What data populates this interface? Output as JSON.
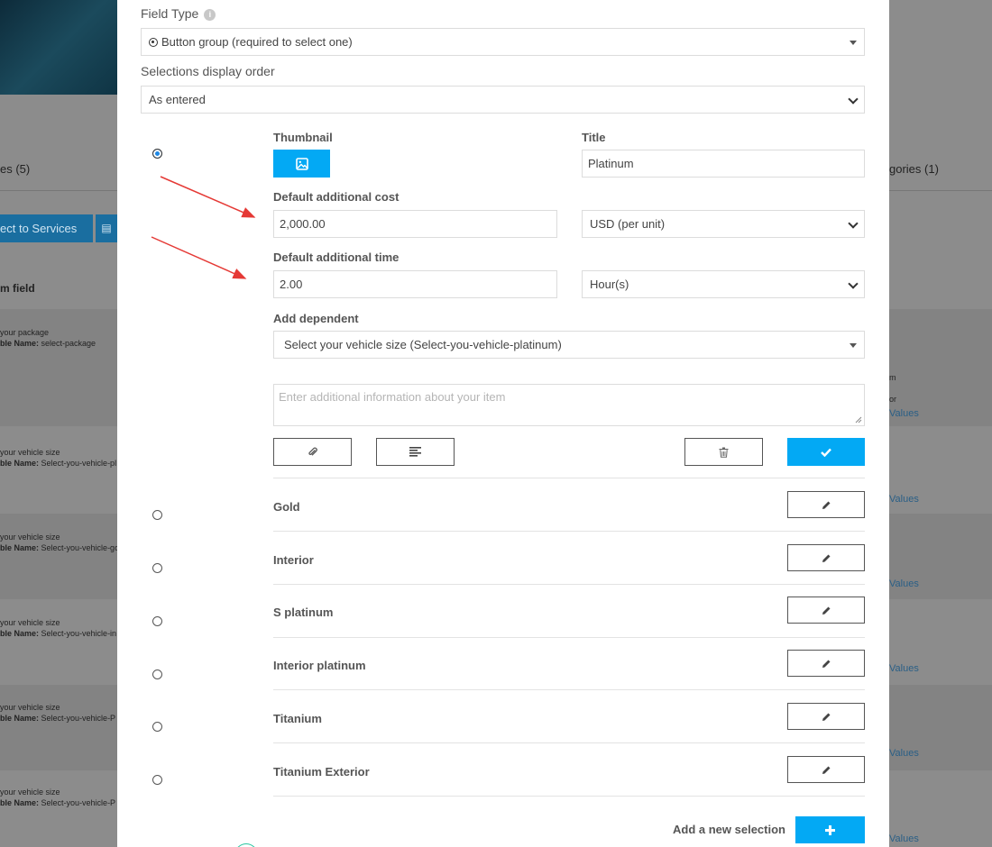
{
  "background": {
    "tab_left": "es (5)",
    "tab_right": "gories (1)",
    "connect_button": "ect to Services",
    "column_header": "m field",
    "rows": [
      {
        "line1": "your package",
        "label": "ble Name:",
        "value": "select-package"
      },
      {
        "line1": "your vehicle size",
        "label": "ble Name:",
        "value": "Select-you-vehicle-pl"
      },
      {
        "line1": "your vehicle size",
        "label": "ble Name:",
        "value": "Select-you-vehicle-go"
      },
      {
        "line1": "your vehicle size",
        "label": "ble Name:",
        "value": "Select-you-vehicle-in"
      },
      {
        "line1": "your vehicle size",
        "label": "ble Name:",
        "value": "Select-you-vehicle-P"
      },
      {
        "line1": "your vehicle size",
        "label": "ble Name:",
        "value": "Select-you-vehicle-P"
      }
    ],
    "right_small_1": "m",
    "right_small_2": "or",
    "values_link": "Values"
  },
  "modal": {
    "field_type_label": "Field Type",
    "field_type_value": "Button group (required to select one)",
    "display_order_label": "Selections display order",
    "display_order_value": "As entered",
    "editor": {
      "thumbnail_label": "Thumbnail",
      "title_label": "Title",
      "title_value": "Platinum",
      "cost_label": "Default additional cost",
      "cost_value": "2,000.00",
      "cost_unit": "USD (per unit)",
      "time_label": "Default additional time",
      "time_value": "2.00",
      "time_unit": "Hour(s)",
      "dependent_label": "Add dependent",
      "dependent_value": "Select your vehicle size (Select-you-vehicle-platinum)",
      "info_placeholder": "Enter additional information about your item"
    },
    "selections": [
      {
        "name": "Gold"
      },
      {
        "name": "Interior"
      },
      {
        "name": "S platinum"
      },
      {
        "name": "Interior platinum"
      },
      {
        "name": "Titanium"
      },
      {
        "name": "Titanium Exterior"
      }
    ],
    "add_selection_label": "Add a new selection"
  },
  "colors": {
    "accent": "#03a9f4",
    "arrow": "#e53935"
  }
}
